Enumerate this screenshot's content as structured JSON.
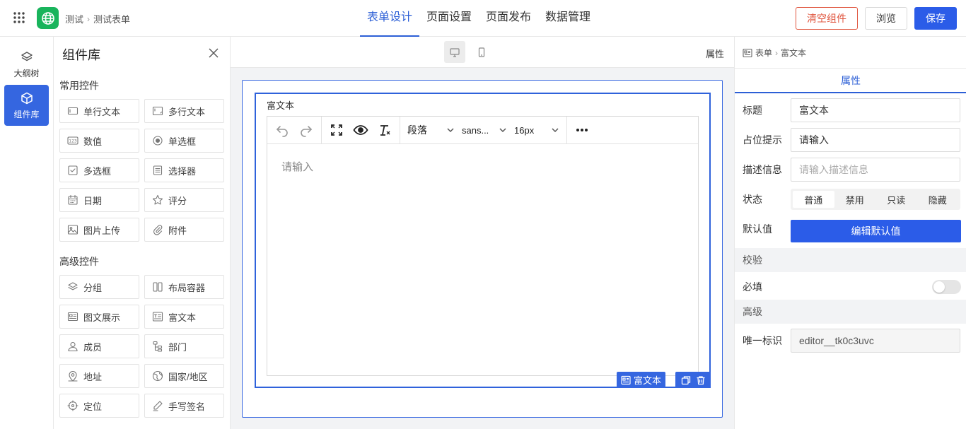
{
  "breadcrumb": {
    "root": "测试",
    "current": "测试表单"
  },
  "top_tabs": [
    {
      "label": "表单设计",
      "active": true
    },
    {
      "label": "页面设置",
      "active": false
    },
    {
      "label": "页面发布",
      "active": false
    },
    {
      "label": "数据管理",
      "active": false
    }
  ],
  "actions": {
    "clear": "清空组件",
    "preview": "浏览",
    "save": "保存"
  },
  "rail": [
    {
      "label": "大纲树",
      "icon": "layers-icon",
      "active": false
    },
    {
      "label": "组件库",
      "icon": "cube-icon",
      "active": true
    }
  ],
  "library": {
    "title": "组件库",
    "common_title": "常用控件",
    "common": [
      {
        "label": "单行文本",
        "icon": "single-line-text-icon"
      },
      {
        "label": "多行文本",
        "icon": "multi-line-text-icon"
      },
      {
        "label": "数值",
        "icon": "number-icon"
      },
      {
        "label": "单选框",
        "icon": "radio-icon"
      },
      {
        "label": "多选框",
        "icon": "checkbox-icon"
      },
      {
        "label": "选择器",
        "icon": "select-icon"
      },
      {
        "label": "日期",
        "icon": "calendar-icon"
      },
      {
        "label": "评分",
        "icon": "star-icon"
      },
      {
        "label": "图片上传",
        "icon": "image-icon"
      },
      {
        "label": "附件",
        "icon": "paperclip-icon"
      }
    ],
    "advanced_title": "高级控件",
    "advanced": [
      {
        "label": "分组",
        "icon": "layers-icon"
      },
      {
        "label": "布局容器",
        "icon": "columns-icon"
      },
      {
        "label": "图文展示",
        "icon": "card-icon"
      },
      {
        "label": "富文本",
        "icon": "rich-text-icon"
      },
      {
        "label": "成员",
        "icon": "user-icon"
      },
      {
        "label": "部门",
        "icon": "org-icon"
      },
      {
        "label": "地址",
        "icon": "map-pin-icon"
      },
      {
        "label": "国家/地区",
        "icon": "globe-icon"
      },
      {
        "label": "定位",
        "icon": "locate-icon"
      },
      {
        "label": "手写签名",
        "icon": "pen-icon"
      }
    ]
  },
  "canvas": {
    "header_right": "属性",
    "field_label": "富文本",
    "toolbar": {
      "paragraph": "段落",
      "font": "sans...",
      "size": "16px"
    },
    "placeholder": "请输入",
    "field_tag": "富文本"
  },
  "properties": {
    "crumb_root": "表单",
    "crumb_current": "富文本",
    "tab": "属性",
    "title_label": "标题",
    "title_value": "富文本",
    "placeholder_label": "占位提示",
    "placeholder_value": "请输入",
    "desc_label": "描述信息",
    "desc_placeholder": "请输入描述信息",
    "status_label": "状态",
    "status_options": [
      "普通",
      "禁用",
      "只读",
      "隐藏"
    ],
    "status_selected": 0,
    "default_label": "默认值",
    "default_button": "编辑默认值",
    "validation_section": "校验",
    "required_label": "必填",
    "required_on": false,
    "advanced_section": "高级",
    "id_label": "唯一标识",
    "id_value": "editor__tk0c3uvc"
  },
  "colors": {
    "primary": "#2b5ce8",
    "danger": "#e0553e",
    "logo": "#19b45c"
  }
}
